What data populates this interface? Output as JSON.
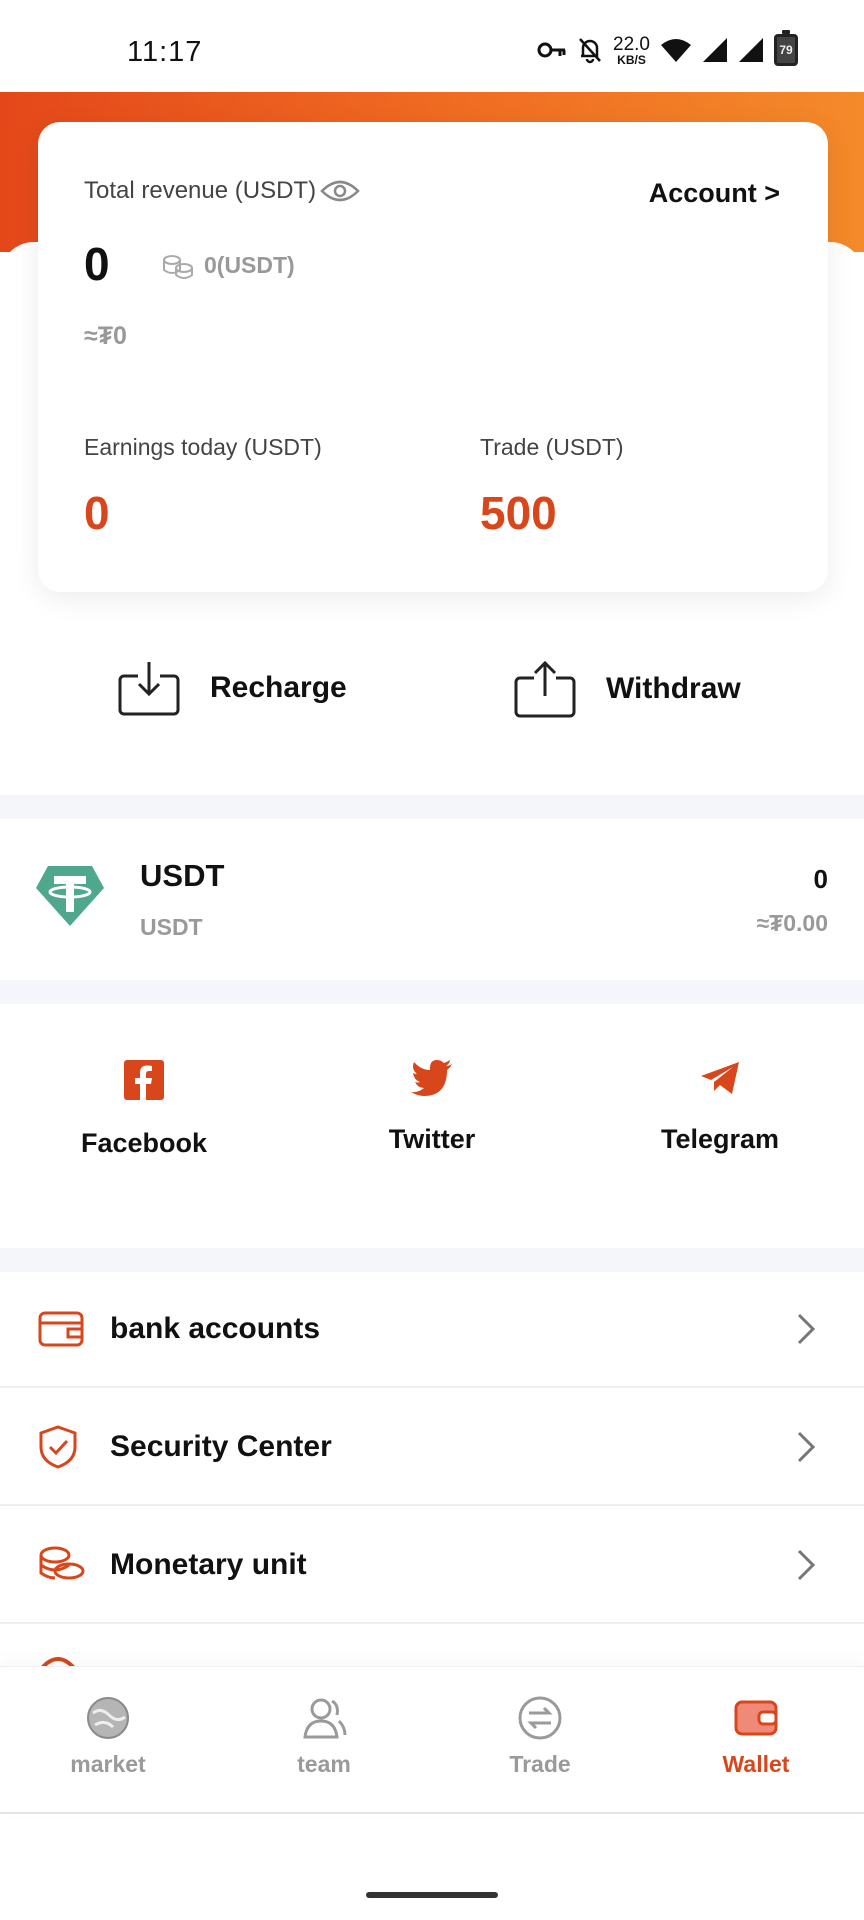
{
  "status_bar": {
    "time": "11:17",
    "net_speed_value": "22.0",
    "net_speed_unit": "KB/S",
    "battery": "79"
  },
  "colors": {
    "accent": "#d8461c",
    "header_gradient_start": "#e4481a",
    "header_gradient_end": "#f48a2a",
    "tether_green": "#4fa88b"
  },
  "revenue_card": {
    "total_label": "Total revenue (USDT)",
    "account_link": "Account >",
    "total_value": "0",
    "coin_value": "0(USDT)",
    "approx_value": "≈₮0",
    "earnings_label": "Earnings today (USDT)",
    "earnings_value": "0",
    "trade_label": "Trade (USDT)",
    "trade_value": "500"
  },
  "actions": {
    "recharge": "Recharge",
    "withdraw": "Withdraw"
  },
  "asset": {
    "name": "USDT",
    "subtitle": "USDT",
    "balance": "0",
    "approx": "≈₮0.00"
  },
  "social": {
    "facebook": "Facebook",
    "twitter": "Twitter",
    "telegram": "Telegram"
  },
  "menu": [
    {
      "label": "bank accounts",
      "icon": "wallet-card-icon"
    },
    {
      "label": "Security Center",
      "icon": "shield-check-icon"
    },
    {
      "label": "Monetary unit",
      "icon": "coins-stack-icon"
    }
  ],
  "tabs": [
    {
      "label": "market",
      "icon": "market-globe-icon",
      "active": false
    },
    {
      "label": "team",
      "icon": "team-users-icon",
      "active": false
    },
    {
      "label": "Trade",
      "icon": "trade-exchange-icon",
      "active": false
    },
    {
      "label": "Wallet",
      "icon": "wallet-icon",
      "active": true
    }
  ]
}
